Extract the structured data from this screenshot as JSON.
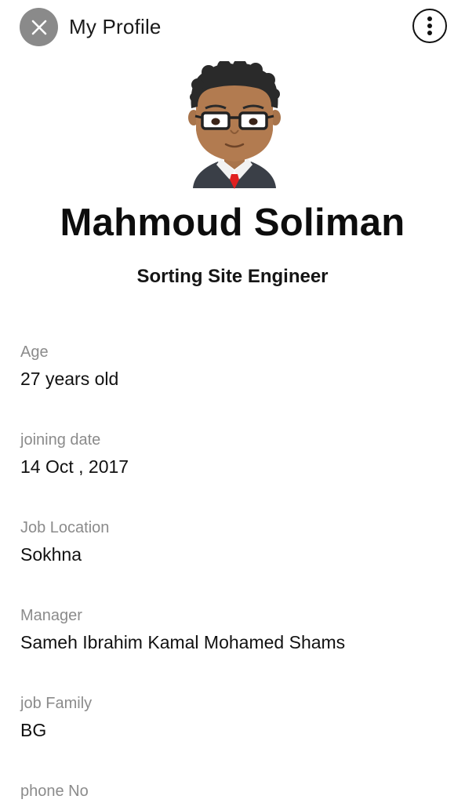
{
  "header": {
    "title": "My Profile",
    "close_icon": "close-icon",
    "more_icon": "more-vertical-icon"
  },
  "profile": {
    "name": "Mahmoud Soliman",
    "role": "Sorting Site Engineer",
    "avatar": "avatar-illustration"
  },
  "fields": [
    {
      "label": "Age",
      "value": "27 years old"
    },
    {
      "label": "joining date",
      "value": "14 Oct , 2017"
    },
    {
      "label": "Job Location",
      "value": "Sokhna"
    },
    {
      "label": "Manager",
      "value": "Sameh Ibrahim Kamal Mohamed Shams"
    },
    {
      "label": "job Family",
      "value": "BG"
    },
    {
      "label": "phone No",
      "value": ""
    }
  ],
  "colors": {
    "close_button_bg": "#8a8a8a",
    "label_gray": "#8b8b8b",
    "text_dark": "#111111",
    "tie_red": "#e02020"
  }
}
